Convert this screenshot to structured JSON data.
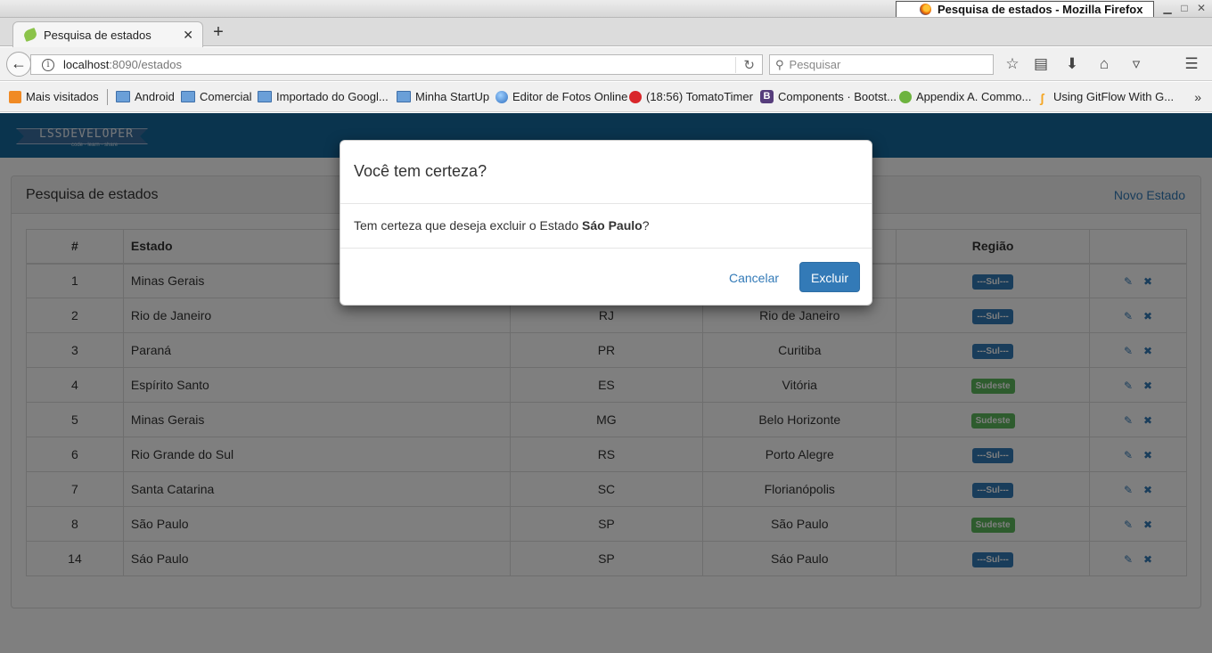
{
  "window": {
    "title": "Pesquisa de estados - Mozilla Firefox"
  },
  "browser": {
    "tab_title": "Pesquisa de estados",
    "url_host": "localhost",
    "url_path": ":8090/estados",
    "search_placeholder": "Pesquisar",
    "bookmarks": [
      "Mais visitados",
      "Android",
      "Comercial",
      "Importado do Googl...",
      "Minha StartUp",
      "Editor de Fotos Online",
      "(18:56) TomatoTimer",
      "Components · Bootst...",
      "Appendix A. Commo...",
      "Using GitFlow With G..."
    ]
  },
  "app": {
    "logo_text": "LSSDEVELOPER",
    "logo_sub": "code · learn · share",
    "panel_title": "Pesquisa de estados",
    "new_link": "Novo Estado",
    "table": {
      "headers": [
        "#",
        "Estado",
        "",
        "",
        "Região",
        ""
      ],
      "rows": [
        {
          "id": "1",
          "estado": "Minas Gerais",
          "uf": "",
          "capital": "",
          "regiao": "---Sul---",
          "tipo": "sul"
        },
        {
          "id": "2",
          "estado": "Rio de Janeiro",
          "uf": "RJ",
          "capital": "Rio de Janeiro",
          "regiao": "---Sul---",
          "tipo": "sul"
        },
        {
          "id": "3",
          "estado": "Paraná",
          "uf": "PR",
          "capital": "Curitiba",
          "regiao": "---Sul---",
          "tipo": "sul"
        },
        {
          "id": "4",
          "estado": "Espírito Santo",
          "uf": "ES",
          "capital": "Vitória",
          "regiao": "Sudeste",
          "tipo": "sudeste"
        },
        {
          "id": "5",
          "estado": "Minas Gerais",
          "uf": "MG",
          "capital": "Belo Horizonte",
          "regiao": "Sudeste",
          "tipo": "sudeste"
        },
        {
          "id": "6",
          "estado": "Rio Grande do Sul",
          "uf": "RS",
          "capital": "Porto Alegre",
          "regiao": "---Sul---",
          "tipo": "sul"
        },
        {
          "id": "7",
          "estado": "Santa Catarina",
          "uf": "SC",
          "capital": "Florianópolis",
          "regiao": "---Sul---",
          "tipo": "sul"
        },
        {
          "id": "8",
          "estado": "São Paulo",
          "uf": "SP",
          "capital": "São Paulo",
          "regiao": "Sudeste",
          "tipo": "sudeste"
        },
        {
          "id": "14",
          "estado": "Sáo Paulo",
          "uf": "SP",
          "capital": "Sáo Paulo",
          "regiao": "---Sul---",
          "tipo": "sul"
        }
      ]
    }
  },
  "modal": {
    "title": "Você tem certeza?",
    "message_prefix": "Tem certeza que deseja excluir o Estado ",
    "message_name": "Sáo Paulo",
    "message_suffix": "?",
    "cancel_label": "Cancelar",
    "confirm_label": "Excluir"
  },
  "colors": {
    "header_blue": "#15699c",
    "primary": "#337ab7",
    "badge_sul": "#337ab7",
    "badge_sudeste": "#5cb85c"
  }
}
